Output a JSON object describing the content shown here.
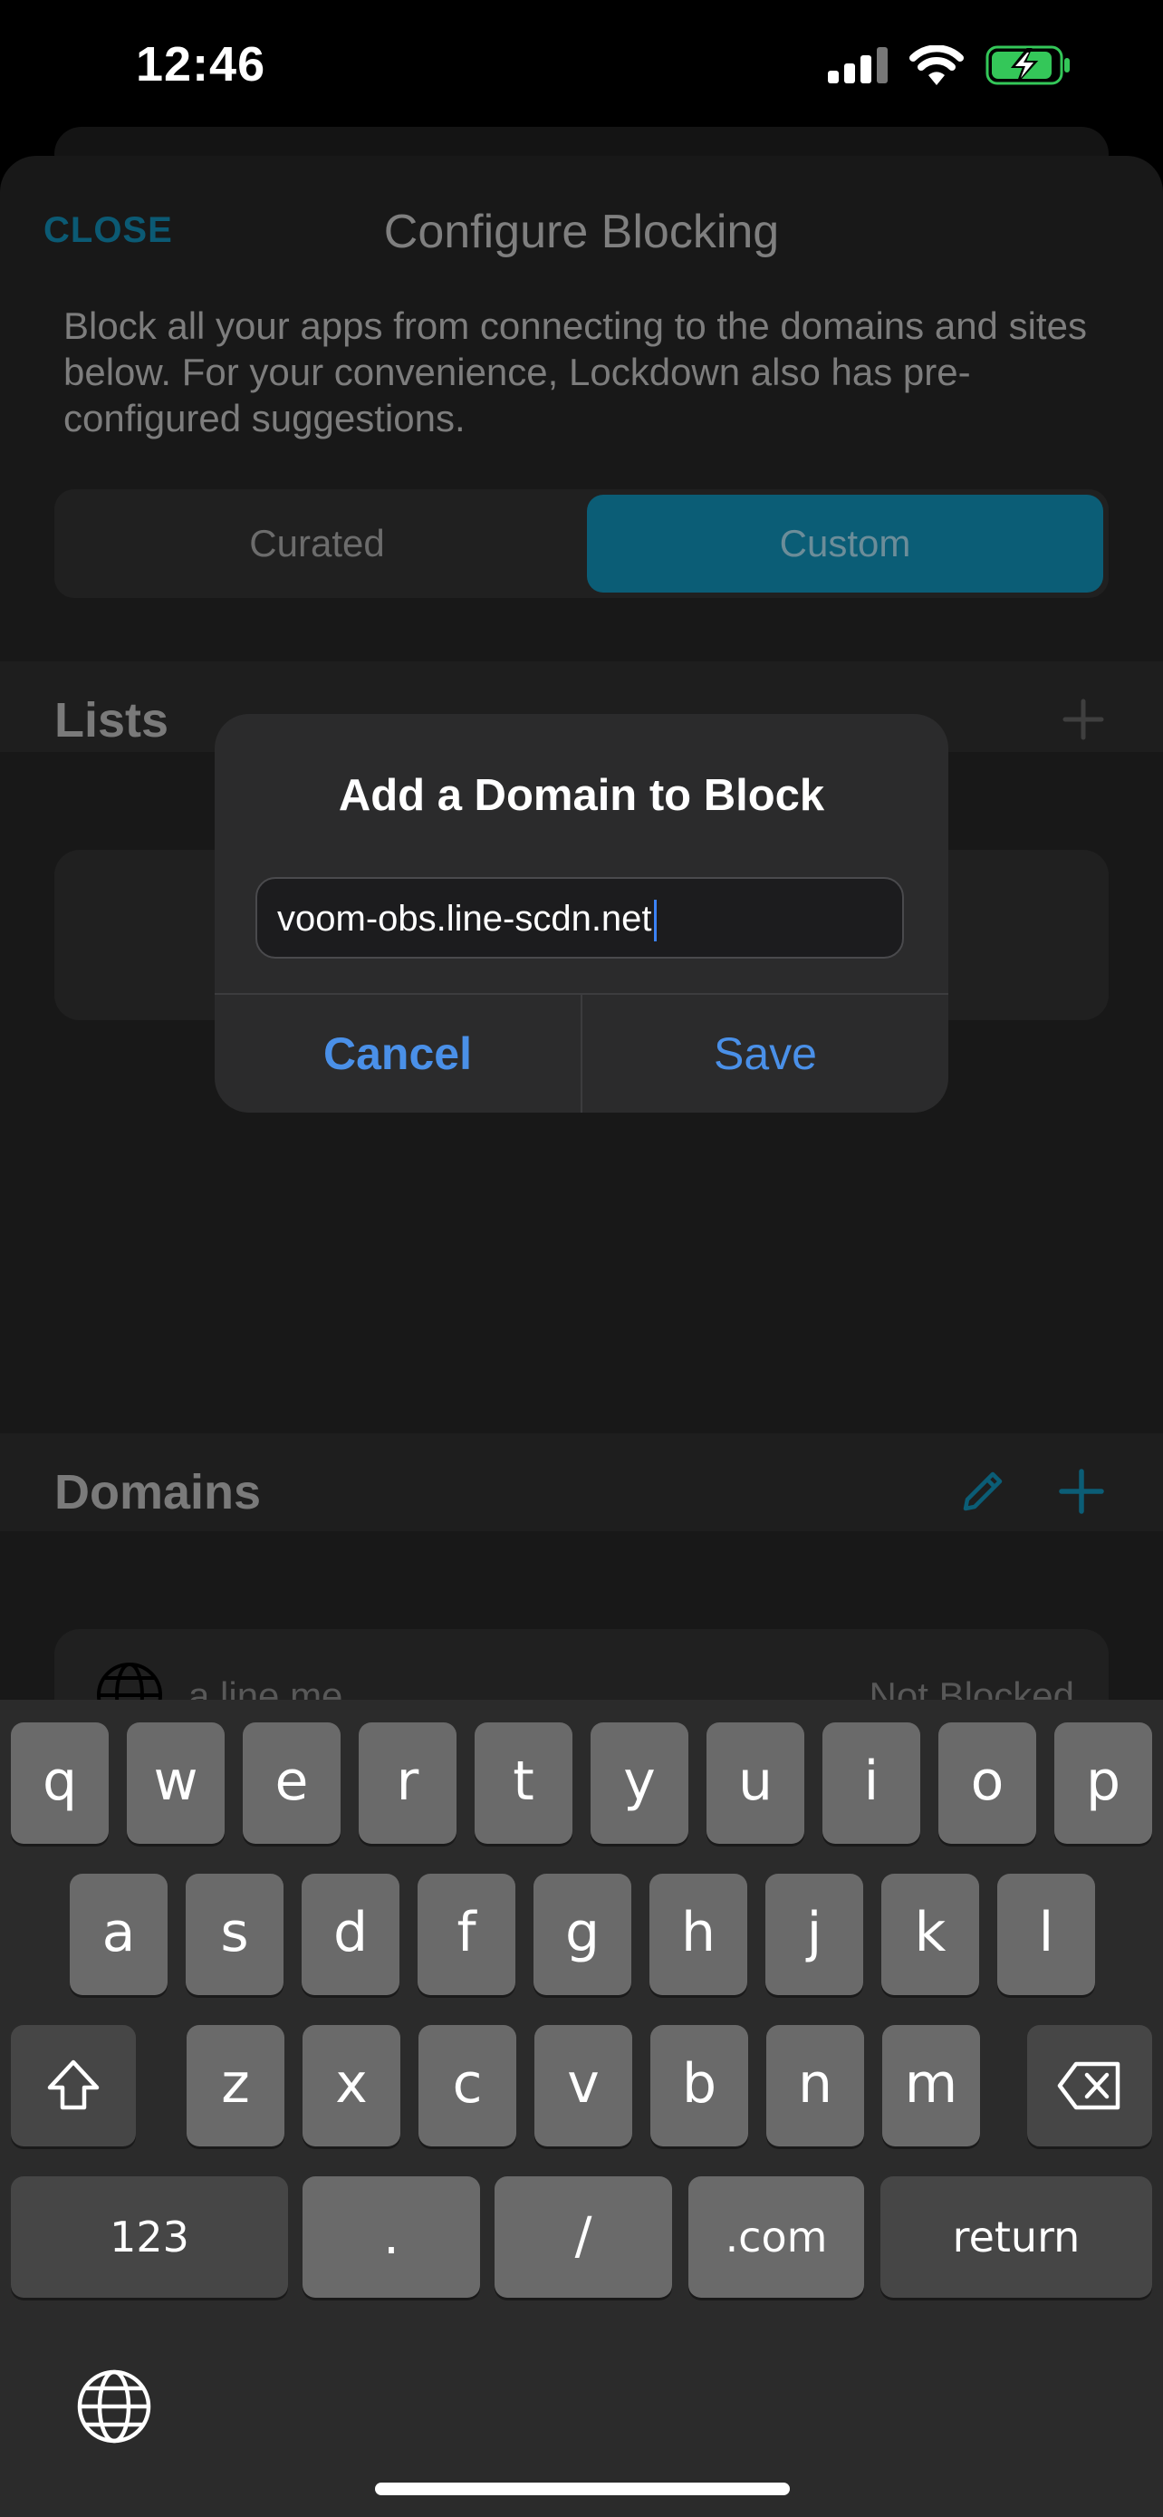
{
  "status_bar": {
    "time": "12:46"
  },
  "header": {
    "close_label": "CLOSE",
    "title": "Configure Blocking"
  },
  "description": "Block all your apps from connecting to the domains and sites below. For your convenience, Lockdown also has pre-configured suggestions.",
  "segments": {
    "curated": "Curated",
    "custom": "Custom",
    "selected": "Custom"
  },
  "lists_section": {
    "title": "Lists"
  },
  "domains_section": {
    "title": "Domains"
  },
  "domain_row": {
    "name": "a.line.me",
    "status": "Not Blocked"
  },
  "alert": {
    "title": "Add a Domain to Block",
    "input_value": "voom-obs.line-scdn.net",
    "cancel_label": "Cancel",
    "save_label": "Save"
  },
  "keyboard": {
    "row1": [
      "q",
      "w",
      "e",
      "r",
      "t",
      "y",
      "u",
      "i",
      "o",
      "p"
    ],
    "row2": [
      "a",
      "s",
      "d",
      "f",
      "g",
      "h",
      "j",
      "k",
      "l"
    ],
    "row3": [
      "z",
      "x",
      "c",
      "v",
      "b",
      "n",
      "m"
    ],
    "numbers_label": "123",
    "dot_label": ".",
    "slash_label": "/",
    "com_label": ".com",
    "return_label": "return"
  },
  "colors": {
    "accent": "#0b5d76",
    "alert_button": "#4a90e8",
    "battery": "#34c759"
  }
}
